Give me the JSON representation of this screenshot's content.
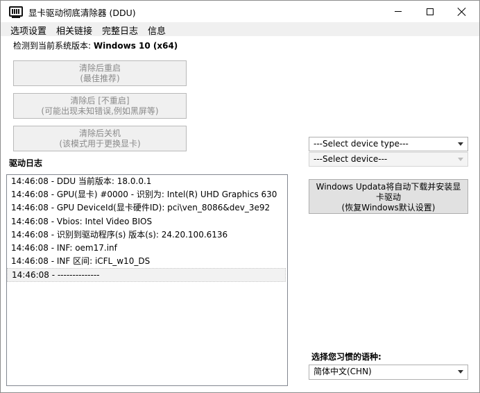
{
  "window": {
    "title": "显卡驱动彻底清除器 (DDU)"
  },
  "menu": {
    "items": [
      "选项设置",
      "相关链接",
      "完整日志",
      "信息"
    ]
  },
  "os": {
    "label": "检测到当前系统版本:",
    "value": "Windows 10 (x64)"
  },
  "actions": {
    "clean_restart": {
      "line1": "清除后重启",
      "line2": "(最佳推荐)"
    },
    "clean_no_restart": {
      "line1": "清除后 [不重启]",
      "line2": "(可能出现未知错误,例如黑屏等)"
    },
    "clean_shutdown": {
      "line1": "清除后关机",
      "line2": "(该模式用于更换显卡)"
    }
  },
  "log": {
    "title": "驱动日志",
    "entries": [
      "14:46:08 - DDU 当前版本: 18.0.0.1",
      "14:46:08 - GPU(显卡) #0000 - 识别为: Intel(R) UHD Graphics 630",
      "14:46:08 - GPU DeviceId(显卡硬件ID): pci\\ven_8086&dev_3e92",
      "14:46:08 - Vbios: Intel Video BIOS",
      "14:46:08 - 识别到驱动程序(s) 版本(s): 24.20.100.6136",
      "14:46:08 - INF: oem17.inf",
      "14:46:08 - INF 区间: iCFL_w10_DS",
      "14:46:08 - --------------"
    ]
  },
  "device_type_select": {
    "value": "---Select device type---"
  },
  "device_select": {
    "value": "---Select device---"
  },
  "windows_update_button": {
    "line1": "Windows Updata将自动下载并安装显",
    "line2": "卡驱动",
    "line3": "(恢复Windows默认设置)"
  },
  "language": {
    "label": "选择您习惯的语种:",
    "value": "简体中文(CHN)"
  },
  "icons": {
    "app": "gpu-card-icon",
    "minimize": "minimize-icon",
    "maximize": "maximize-icon",
    "close": "close-icon"
  }
}
